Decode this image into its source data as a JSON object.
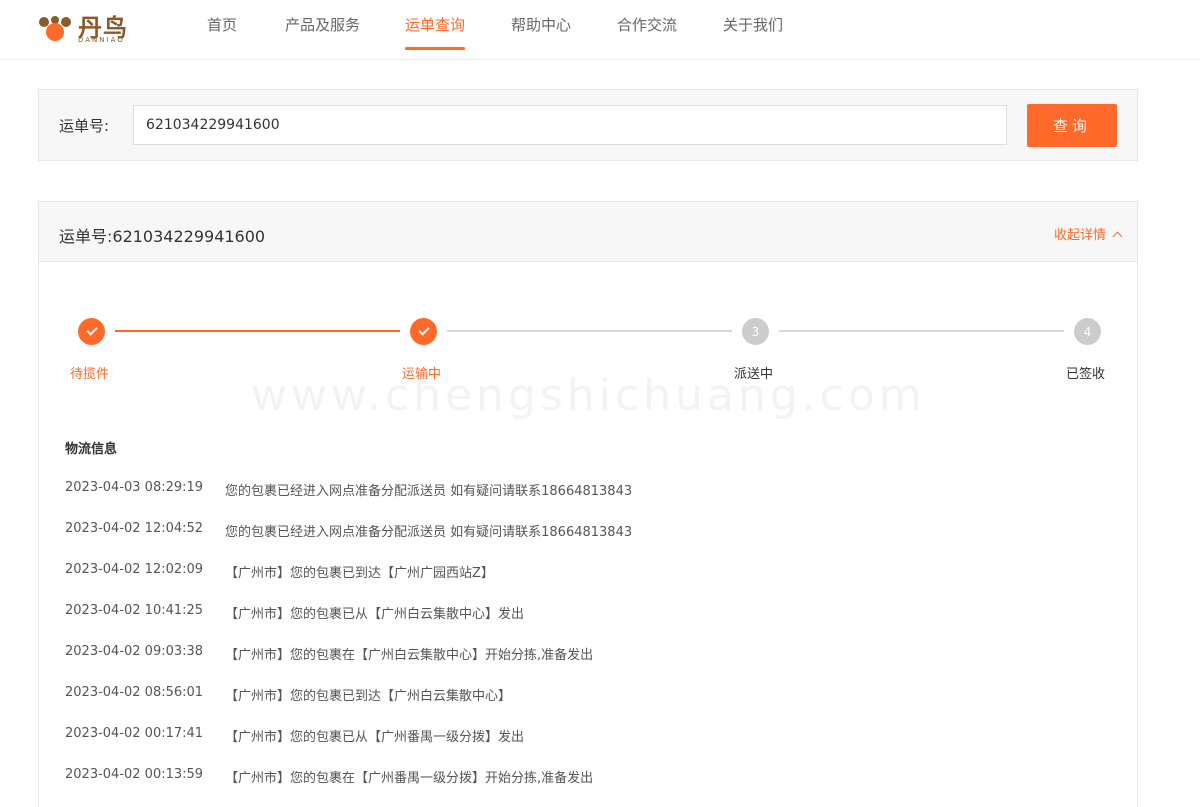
{
  "brand": {
    "name_cn": "丹鸟",
    "name_en": "DANNIAO"
  },
  "nav": {
    "items": [
      {
        "label": "首页"
      },
      {
        "label": "产品及服务"
      },
      {
        "label": "运单查询"
      },
      {
        "label": "帮助中心"
      },
      {
        "label": "合作交流"
      },
      {
        "label": "关于我们"
      }
    ],
    "active": "运单查询"
  },
  "query": {
    "label": "运单号:",
    "value": "621034229941600",
    "button": "查询"
  },
  "result": {
    "title": "运单号:621034229941600",
    "collapse_label": "收起详情",
    "steps": [
      {
        "label": "待揽件",
        "status": "done"
      },
      {
        "label": "运输中",
        "status": "done"
      },
      {
        "label": "派送中",
        "status": "pending",
        "number": "3"
      },
      {
        "label": "已签收",
        "status": "pending",
        "number": "4"
      }
    ],
    "watermark": "www.chengshichuang.com",
    "logistics_title": "物流信息",
    "logistics": [
      {
        "time": "2023-04-03 08:29:19",
        "message": "您的包裹已经进入网点准备分配派送员 如有疑问请联系18664813843"
      },
      {
        "time": "2023-04-02 12:04:52",
        "message": "您的包裹已经进入网点准备分配派送员 如有疑问请联系18664813843"
      },
      {
        "time": "2023-04-02 12:02:09",
        "message": "【广州市】您的包裹已到达【广州广园西站Z】"
      },
      {
        "time": "2023-04-02 10:41:25",
        "message": "【广州市】您的包裹已从【广州白云集散中心】发出"
      },
      {
        "time": "2023-04-02 09:03:38",
        "message": "【广州市】您的包裹在【广州白云集散中心】开始分拣,准备发出"
      },
      {
        "time": "2023-04-02 08:56:01",
        "message": "【广州市】您的包裹已到达【广州白云集散中心】"
      },
      {
        "time": "2023-04-02 00:17:41",
        "message": "【广州市】您的包裹已从【广州番禺一级分拨】发出"
      },
      {
        "time": "2023-04-02 00:13:59",
        "message": "【广州市】您的包裹在【广州番禺一级分拨】开始分拣,准备发出"
      }
    ]
  },
  "colors": {
    "accent": "#ff6a2a",
    "logo_brown": "#8a5a2b",
    "pending": "#cccccc"
  }
}
